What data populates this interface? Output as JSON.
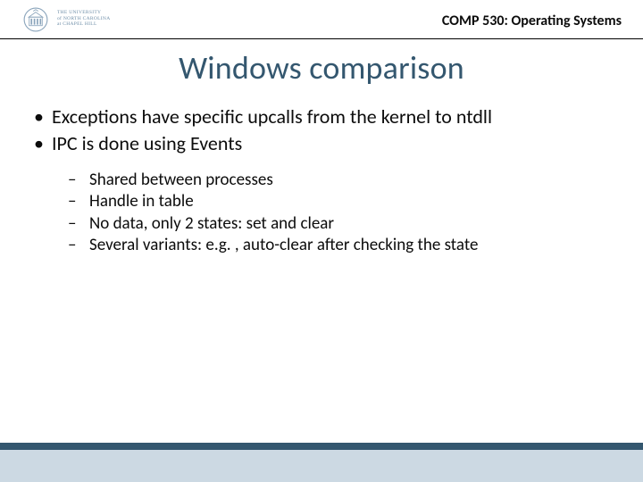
{
  "header": {
    "logo_line1": "THE UNIVERSITY",
    "logo_line2": "of NORTH CAROLINA",
    "logo_line3": "at CHAPEL HILL",
    "course_label": "COMP 530: Operating Systems"
  },
  "title": "Windows comparison",
  "bullets": {
    "l1_0": "Exceptions have specific upcalls from the kernel to ntdll",
    "l1_1": "IPC is done using Events",
    "l2_0": "Shared between processes",
    "l2_1": "Handle in table",
    "l2_2": "No data, only 2 states: set and clear",
    "l2_3": "Several variants: e.g. , auto-clear after checking the state"
  },
  "colors": {
    "title": "#34576f",
    "footer_band": "#ccd9e3",
    "footer_stripe": "#34576f"
  }
}
